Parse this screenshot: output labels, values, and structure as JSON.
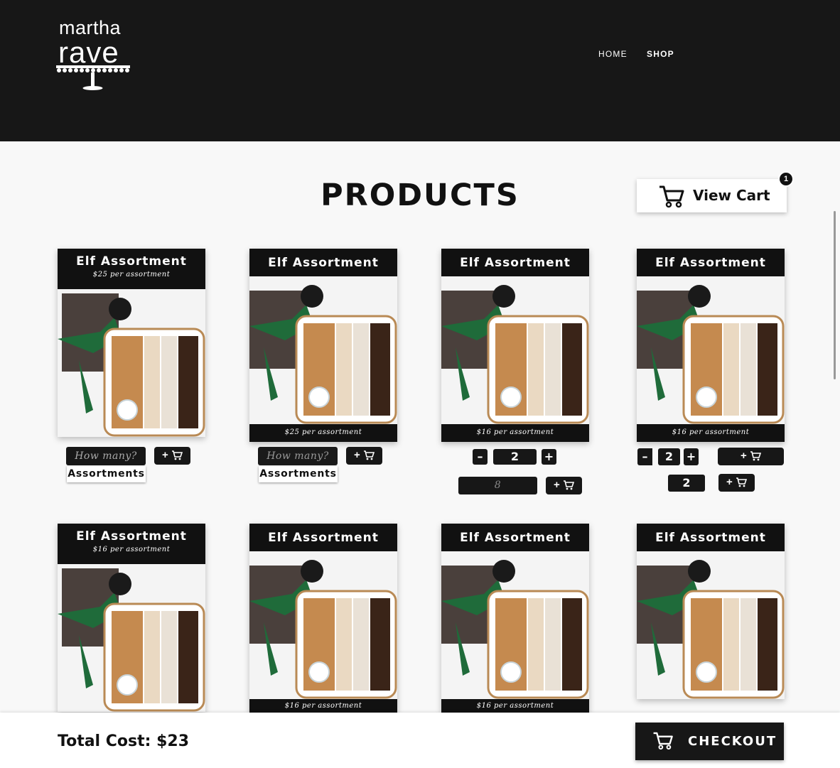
{
  "brand": {
    "line1": "martha",
    "line2": "rave"
  },
  "nav": {
    "home": "HOME",
    "shop": "SHOP"
  },
  "page_title": "PRODUCTS",
  "view_cart": {
    "label": "View Cart",
    "count": "1"
  },
  "products": [
    {
      "name": "Elf Assortment",
      "price": "$25 per assortment"
    },
    {
      "name": "Elf Assortment",
      "price": "$25 per assortment"
    },
    {
      "name": "Elf Assortment",
      "price": "$16 per assortment"
    },
    {
      "name": "Elf Assortment",
      "price": "$16 per assortment"
    },
    {
      "name": "Elf Assortment",
      "price": "$16 per assortment"
    },
    {
      "name": "Elf Assortment",
      "price": "$16 per assortment"
    },
    {
      "name": "Elf Assortment",
      "price": "$16 per assortment"
    },
    {
      "name": "Elf Assortment",
      "price": ""
    }
  ],
  "controls": {
    "qty_placeholder": "How many?",
    "unit_label": "Assortments",
    "add_label": "+",
    "card3_quantity": "2",
    "card3_input_value": "8",
    "card4_quantity": "2",
    "card4_display_value": "2",
    "minus": "–",
    "plus": "+"
  },
  "footer": {
    "total": "Total Cost: $23",
    "checkout": "CHECKOUT"
  },
  "colors": {
    "header_bg": "#171717",
    "page_bg": "#f8f8f8",
    "ribbon": "#1f6b3a"
  },
  "icons": [
    "cart-icon",
    "minus-icon",
    "plus-icon",
    "cake-stand-icon"
  ]
}
